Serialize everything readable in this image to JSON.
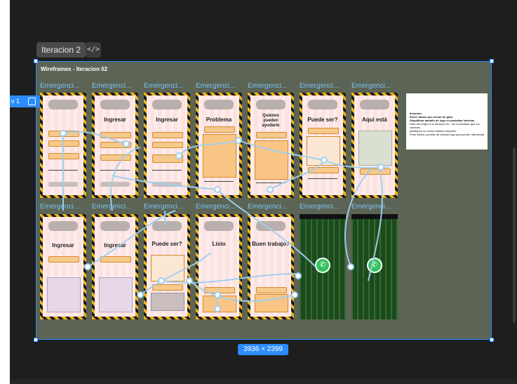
{
  "toolbar": {
    "tag_label": "Iteracion 2",
    "code_icon_glyph": "</>"
  },
  "frame": {
    "title": "Wireframes - Iteracion 02",
    "dimensions": "3936 × 2399",
    "side_tag_label": "v 1"
  },
  "screens_row1": [
    {
      "label": "Emergenci...",
      "title": ""
    },
    {
      "label": "Emergenci...",
      "title": "Ingresar"
    },
    {
      "label": "Emergenci...",
      "title": "Ingresar"
    },
    {
      "label": "Emergenci...",
      "title": "Problema"
    },
    {
      "label": "Emergenci...",
      "title": "Quienes pueden ayudarte"
    },
    {
      "label": "Emergenci...",
      "title": "Puede ser?"
    },
    {
      "label": "Emergenci...",
      "title": "Aqui está"
    }
  ],
  "screens_row2": [
    {
      "label": "Emergenci...",
      "title": "Ingresar"
    },
    {
      "label": "Emergenci...",
      "title": "Ingresar"
    },
    {
      "label": "Emergenci...",
      "title": "Puede ser?"
    },
    {
      "label": "Emergenci...",
      "title": "Listo"
    },
    {
      "label": "Emergenci...",
      "title": "Buen trabajo?"
    },
    {
      "label": "Emergenci...",
      "title": ""
    },
    {
      "label": "Emergenci...",
      "title": ""
    }
  ],
  "note": {
    "lines": [
      "Iteración:",
      "Poner titulos que sirvan de guía.",
      "Simplificar tamaño de logo en pantallas internas.",
      "Dato del origen a la iteración 2b - No consultado que los cambios",
      "justifiquen un nuevo estado completo.",
      "Pone titulos y probar de achicar logo para perder intensidad"
    ]
  },
  "colors": {
    "canvas": "#1e1e1e",
    "frame_bg": "#5b6455",
    "selection": "#2a8cff",
    "connector": "#9fd0f0"
  }
}
